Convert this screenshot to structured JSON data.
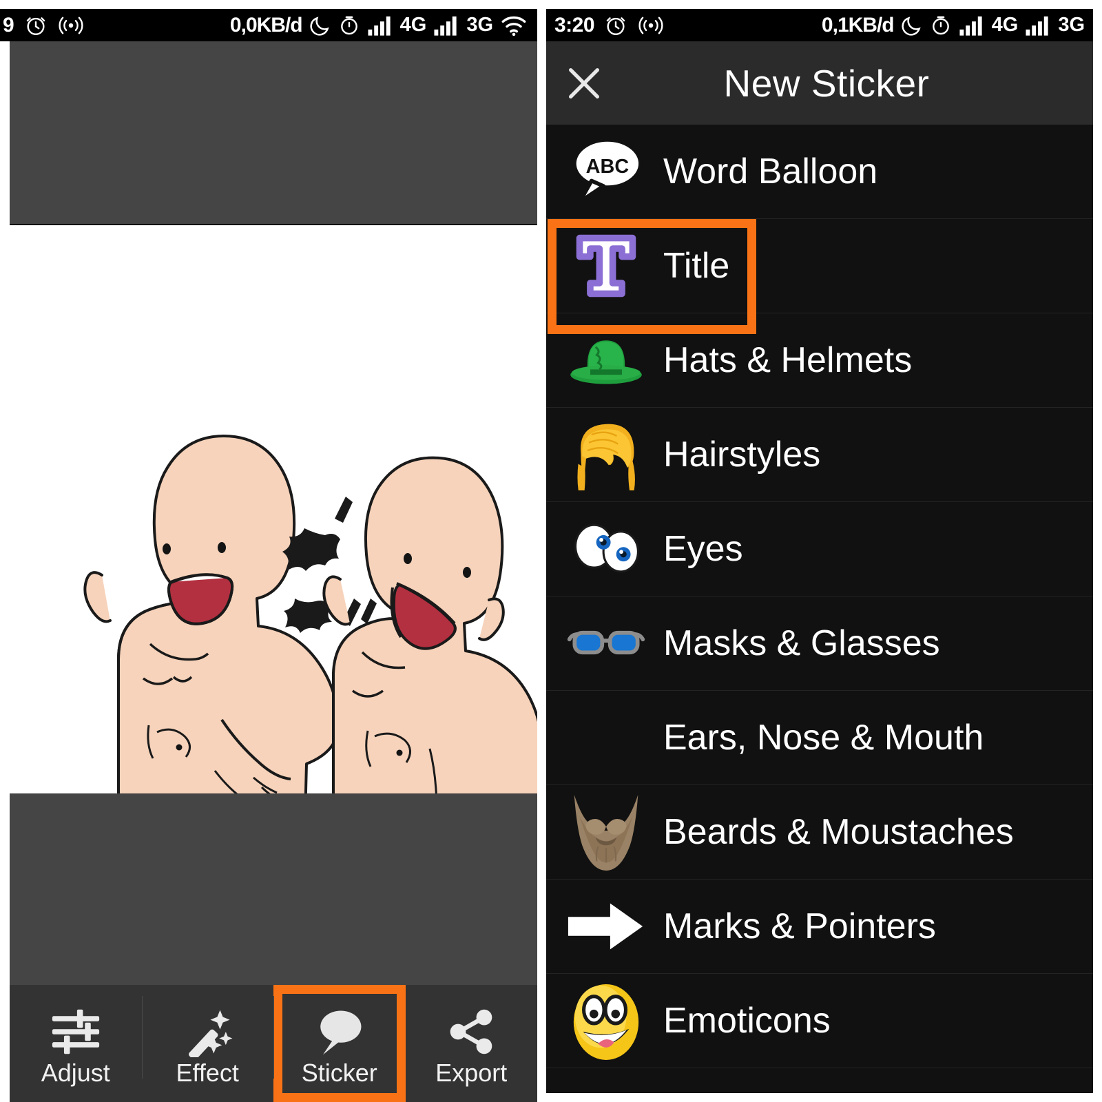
{
  "left": {
    "status_bar": {
      "clipped_text": "9",
      "alarm_icon": "alarm-clock-icon",
      "cast_icon": "broadcast-icon",
      "data_rate": "0,0KB/d",
      "moon_icon": "moon-icon",
      "timer_icon": "timer-icon",
      "signal1_label": "4G",
      "signal2_label": "3G",
      "wifi_icon": "wifi-icon"
    },
    "toolbar": {
      "items": [
        {
          "label": "Adjust",
          "icon": "sliders-icon",
          "selected": false
        },
        {
          "label": "Effect",
          "icon": "magic-wand-icon",
          "selected": false
        },
        {
          "label": "Sticker",
          "icon": "speech-bubble-icon",
          "selected": true
        },
        {
          "label": "Export",
          "icon": "share-icon",
          "selected": false
        }
      ]
    },
    "photo": {
      "description": "Cartoon drawing of two bald figures with open mouths shouting at each other"
    }
  },
  "right": {
    "status_bar": {
      "time": "3:20",
      "alarm_icon": "alarm-clock-icon",
      "cast_icon": "broadcast-icon",
      "data_rate": "0,1KB/d",
      "moon_icon": "moon-icon",
      "timer_icon": "timer-icon",
      "signal1_label": "4G",
      "signal2_label": "3G"
    },
    "header": {
      "close_icon": "close-icon",
      "title": "New Sticker"
    },
    "accent_color": "#f97316",
    "list": {
      "items": [
        {
          "label": "Word Balloon",
          "icon": "word-balloon-icon",
          "highlighted": false
        },
        {
          "label": "Title",
          "icon": "title-t-icon",
          "highlighted": true
        },
        {
          "label": "Hats & Helmets",
          "icon": "bowler-hat-icon",
          "highlighted": false
        },
        {
          "label": "Hairstyles",
          "icon": "hairstyle-icon",
          "highlighted": false
        },
        {
          "label": "Eyes",
          "icon": "eyes-icon",
          "highlighted": false
        },
        {
          "label": "Masks & Glasses",
          "icon": "glasses-icon",
          "highlighted": false
        },
        {
          "label": "Ears, Nose & Mouth",
          "icon": "none",
          "highlighted": false
        },
        {
          "label": "Beards & Moustaches",
          "icon": "beard-icon",
          "highlighted": false
        },
        {
          "label": "Marks & Pointers",
          "icon": "arrow-right-icon",
          "highlighted": false
        },
        {
          "label": "Emoticons",
          "icon": "smiley-icon",
          "highlighted": false
        }
      ]
    }
  }
}
